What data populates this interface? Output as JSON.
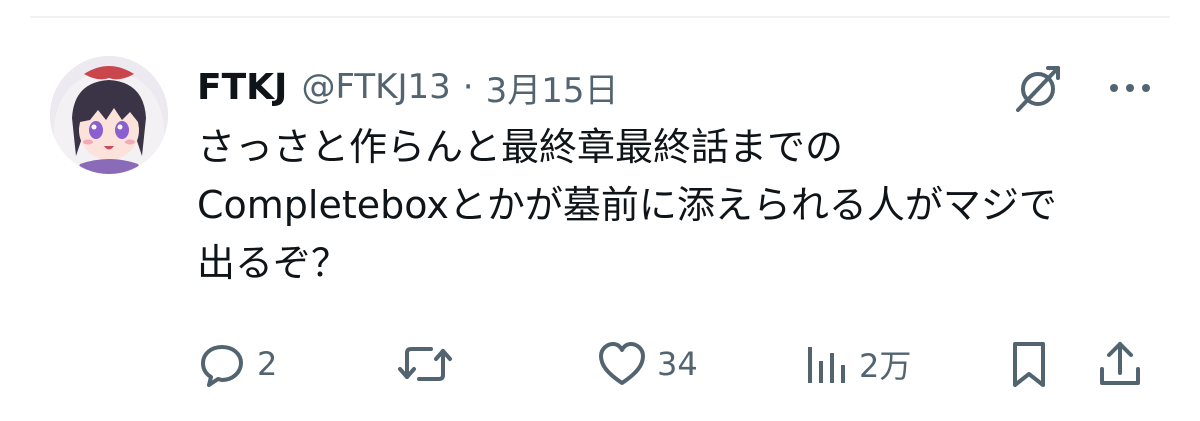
{
  "tweet": {
    "author": {
      "display_name": "FTKJ",
      "handle": "@FTKJ13",
      "separator": "·",
      "date": "3月15日"
    },
    "text": "さっさと作らんと最終章最終話までの\nCompleteboxとかが墓前に添えられる人がマジで\n出るぞ？",
    "header_icons": [
      "grok-icon",
      "more-icon"
    ],
    "actions": {
      "reply": {
        "icon": "reply-icon",
        "count": "2"
      },
      "repost": {
        "icon": "repost-icon",
        "count": ""
      },
      "like": {
        "icon": "like-icon",
        "count": "34"
      },
      "views": {
        "icon": "views-icon",
        "count": "2万"
      },
      "bookmark": {
        "icon": "bookmark-icon"
      },
      "share": {
        "icon": "share-icon"
      }
    }
  },
  "colors": {
    "text_primary": "#0f1419",
    "text_secondary": "#536471",
    "divider": "#eff3f4"
  }
}
